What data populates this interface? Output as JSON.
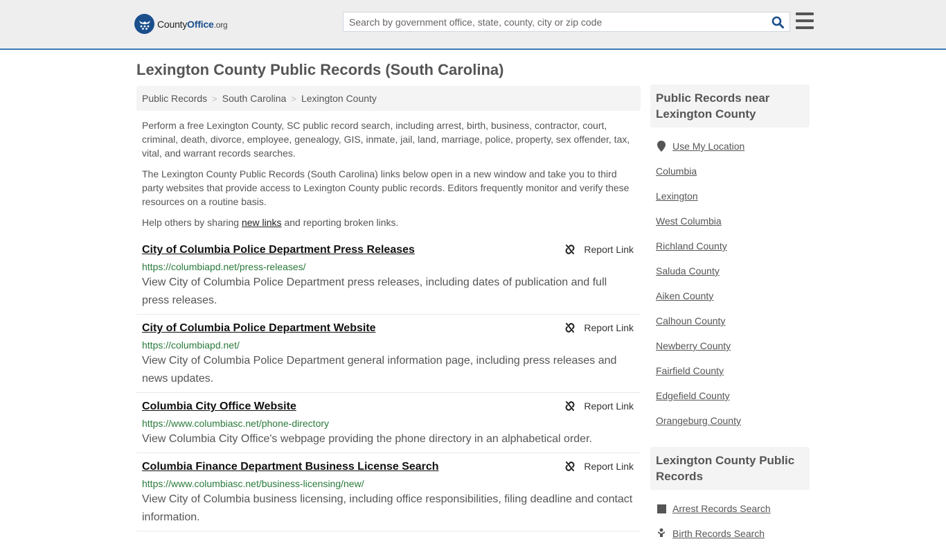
{
  "header": {
    "logo": {
      "name_part1": "County",
      "name_part2": "Office",
      "tld": ".org"
    },
    "search": {
      "placeholder": "Search by government office, state, county, city or zip code",
      "value": ""
    },
    "colors": {
      "accent": "#3d7ab5",
      "brand": "#1a4f8c"
    }
  },
  "page": {
    "title": "Lexington County Public Records (South Carolina)"
  },
  "breadcrumb": [
    {
      "label": "Public Records"
    },
    {
      "label": "South Carolina"
    },
    {
      "label": "Lexington County"
    }
  ],
  "breadcrumb_separator": ">",
  "intro": {
    "p1": "Perform a free Lexington County, SC public record search, including arrest, birth, business, contractor, court, criminal, death, divorce, employee, genealogy, GIS, inmate, jail, land, marriage, police, property, sex offender, tax, vital, and warrant records searches.",
    "p2": "The Lexington County Public Records (South Carolina) links below open in a new window and take you to third party websites that provide access to Lexington County public records. Editors frequently monitor and verify these resources on a routine basis.",
    "p3_before": "Help others by sharing ",
    "p3_link": "new links",
    "p3_after": " and reporting broken links."
  },
  "report_label": "Report Link",
  "records": [
    {
      "title": "City of Columbia Police Department Press Releases",
      "url": "https://columbiapd.net/press-releases/",
      "description": "View City of Columbia Police Department press releases, including dates of publication and full press releases."
    },
    {
      "title": "City of Columbia Police Department Website",
      "url": "https://columbiapd.net/",
      "description": "View City of Columbia Police Department general information page, including press releases and news updates."
    },
    {
      "title": "Columbia City Office Website",
      "url": "https://www.columbiasc.net/phone-directory",
      "description": "View Columbia City Office's webpage providing the phone directory in an alphabetical order."
    },
    {
      "title": "Columbia Finance Department Business License Search",
      "url": "https://www.columbiasc.net/business-licensing/new/",
      "description": "View City of Columbia business licensing, including office responsibilities, filing deadline and contact information."
    }
  ],
  "sidebar": {
    "nearby": {
      "heading": "Public Records near Lexington County",
      "use_location": "Use My Location",
      "items": [
        "Columbia",
        "Lexington",
        "West Columbia",
        "Richland County",
        "Saluda County",
        "Aiken County",
        "Calhoun County",
        "Newberry County",
        "Fairfield County",
        "Edgefield County",
        "Orangeburg County"
      ]
    },
    "county_records": {
      "heading": "Lexington County Public Records",
      "items": [
        {
          "label": "Arrest Records Search",
          "icon": "square-icon"
        },
        {
          "label": "Birth Records Search",
          "icon": "baby-icon"
        }
      ]
    }
  }
}
